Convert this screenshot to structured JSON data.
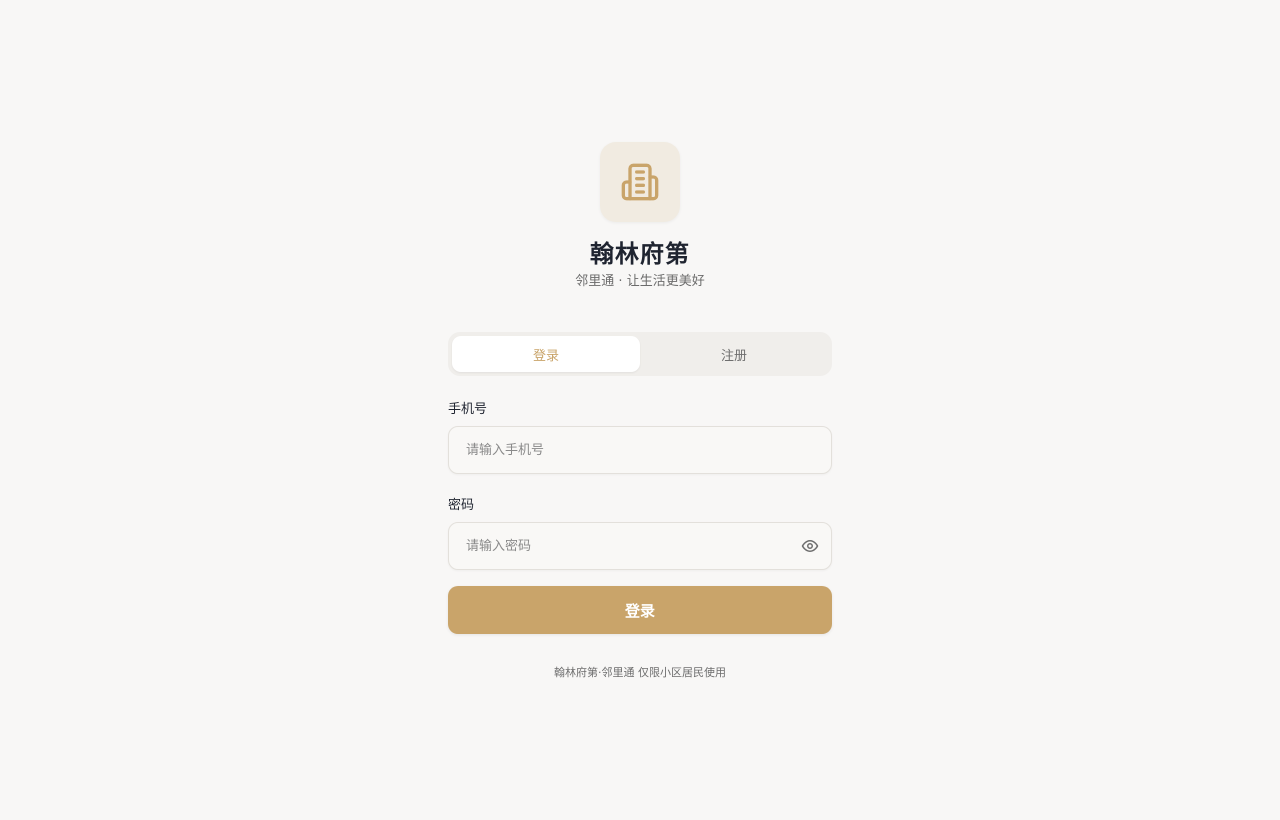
{
  "brand": {
    "logo_icon": "building-icon",
    "title": "翰林府第",
    "subtitle": "邻里通 · 让生活更美好",
    "accent_color": "#c9a46a"
  },
  "tabs": [
    {
      "label": "登录",
      "active": true
    },
    {
      "label": "注册",
      "active": false
    }
  ],
  "form": {
    "phone": {
      "label": "手机号",
      "placeholder": "请输入手机号",
      "value": ""
    },
    "password": {
      "label": "密码",
      "placeholder": "请输入密码",
      "value": "",
      "toggle_icon": "eye-icon"
    },
    "submit_label": "登录"
  },
  "footer": {
    "note": "翰林府第·邻里通 仅限小区居民使用"
  }
}
